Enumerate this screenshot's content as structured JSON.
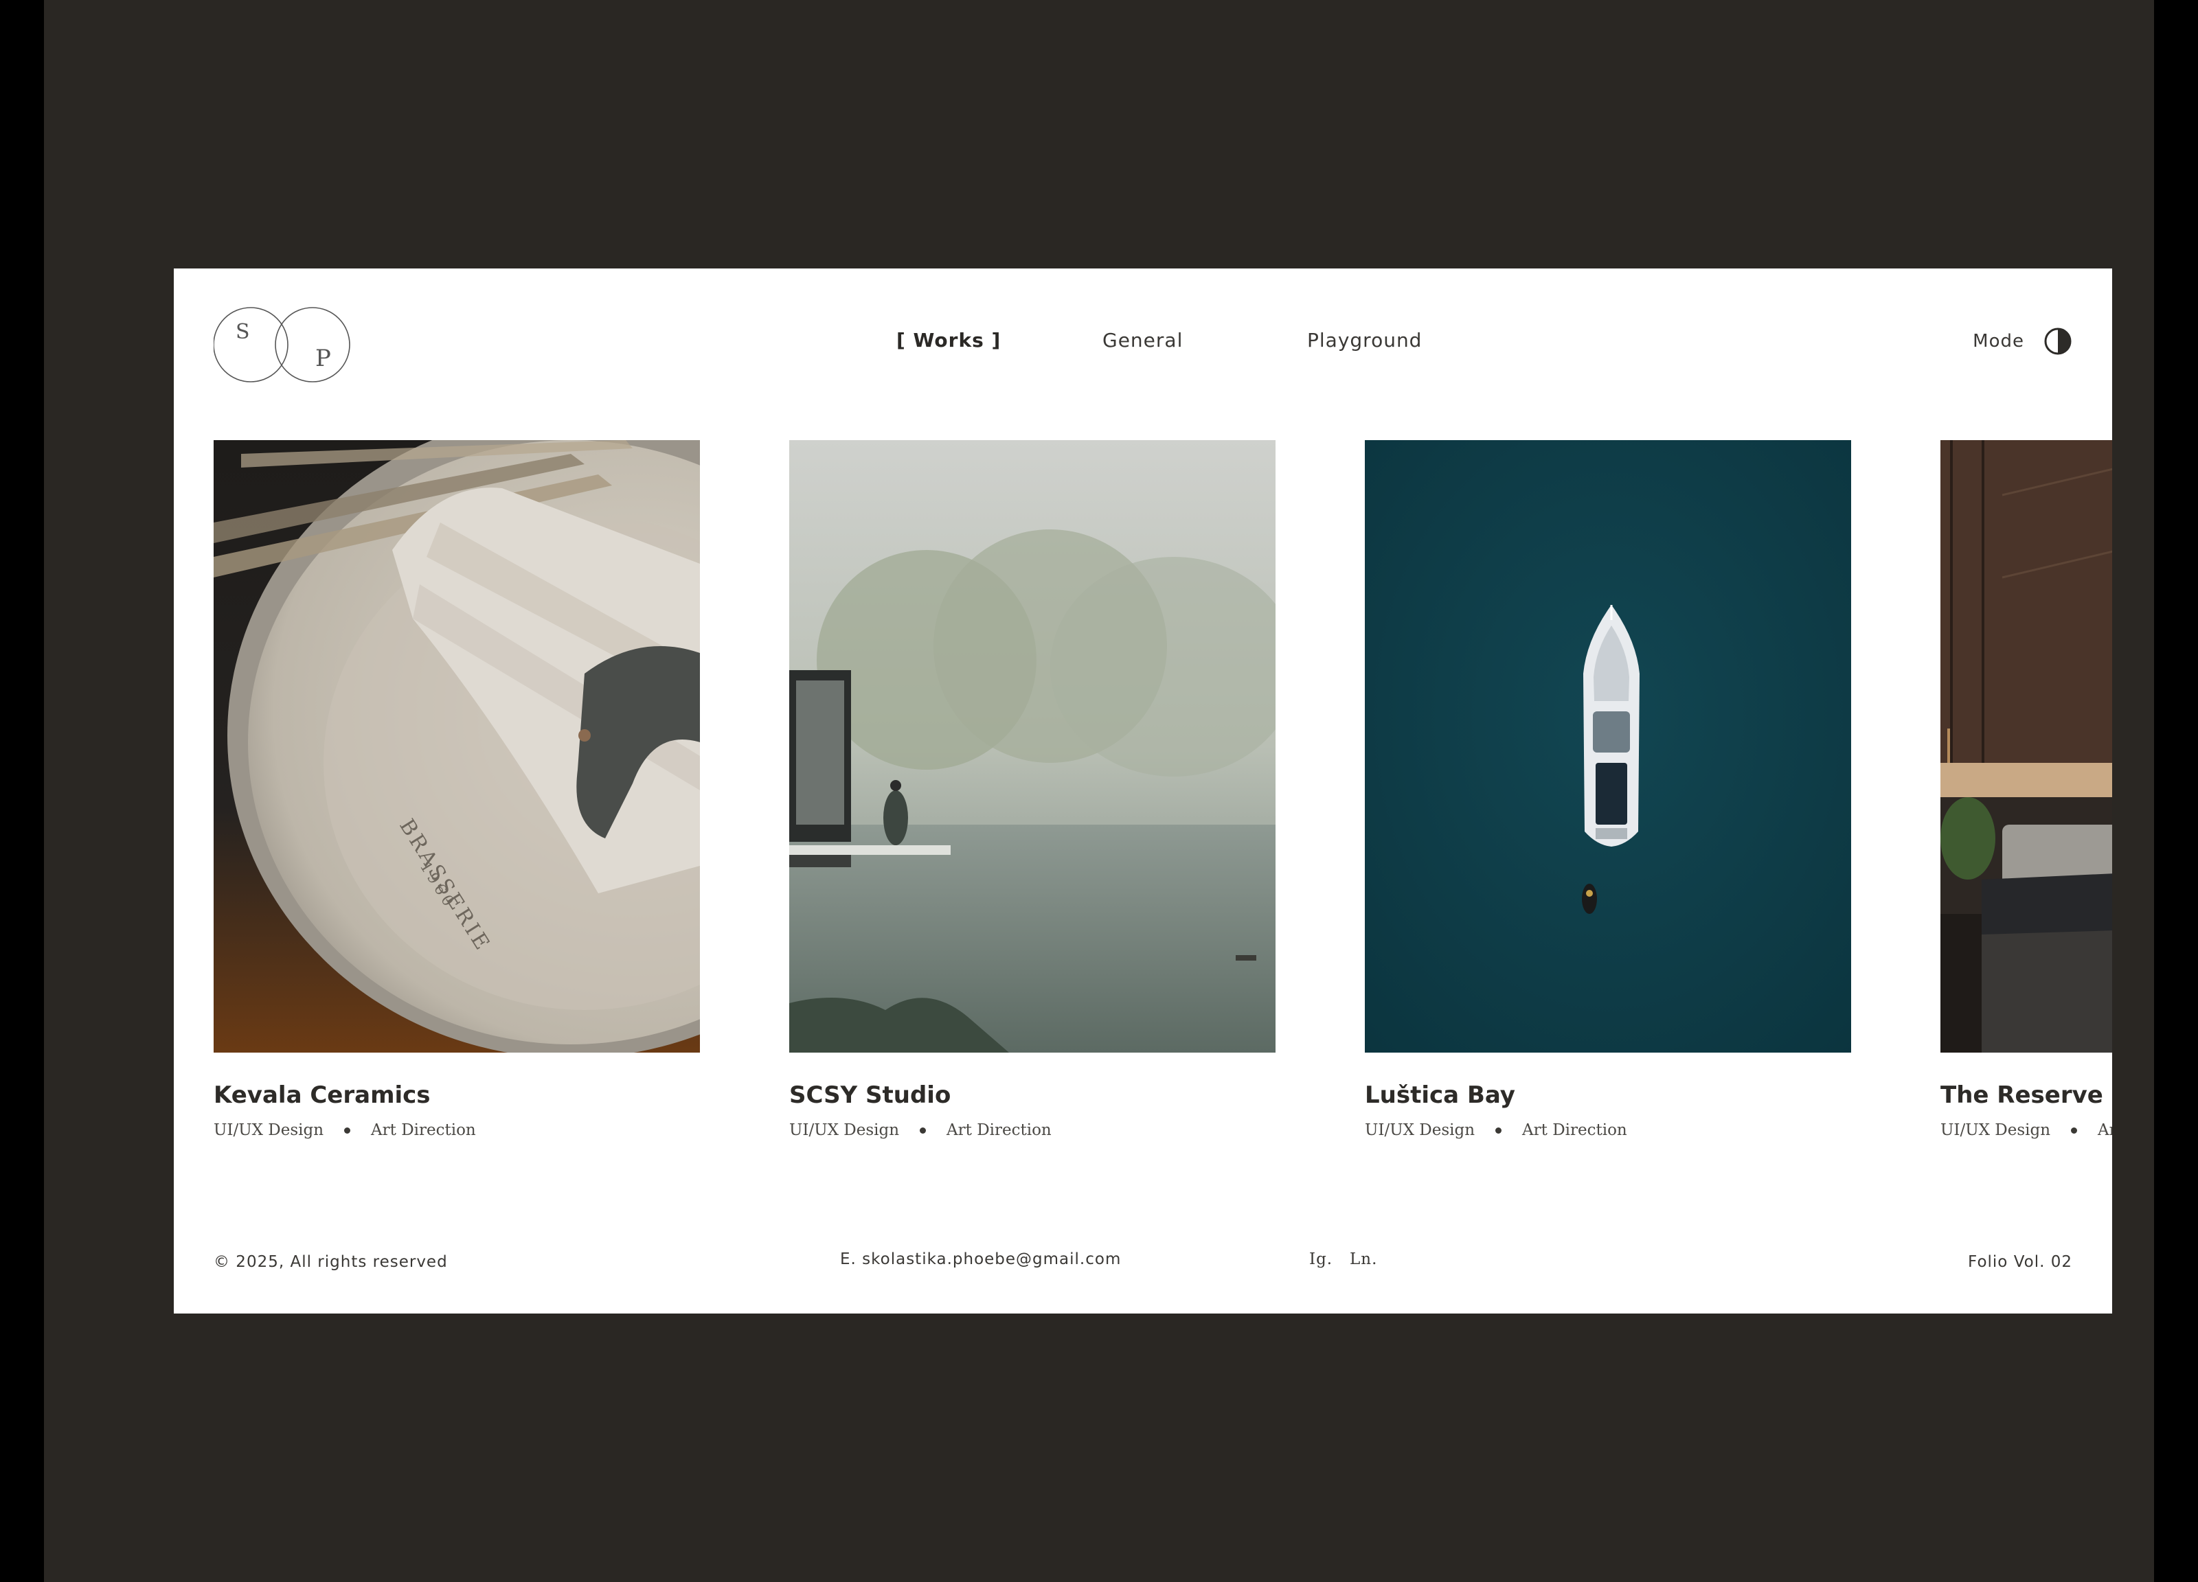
{
  "header": {
    "logo_letters": [
      "S",
      "P"
    ],
    "nav": [
      {
        "label": "[ Works ]",
        "active": true
      },
      {
        "label": "General",
        "active": false
      },
      {
        "label": "Playground",
        "active": false
      }
    ],
    "mode_label": "Mode"
  },
  "projects": [
    {
      "title": "Kevala Ceramics",
      "tags": [
        "UI/UX Design",
        "Art Direction"
      ],
      "image": "ceramic plate with napkin and forks"
    },
    {
      "title": "SCSY Studio",
      "tags": [
        "UI/UX Design",
        "Art Direction"
      ],
      "image": "misty lake with pavilion and figure"
    },
    {
      "title": "Luštica Bay",
      "tags": [
        "UI/UX Design",
        "Art Direction"
      ],
      "image": "aerial view of yacht on dark teal water"
    },
    {
      "title": "The Reserve Res",
      "tags": [
        "UI/UX Design",
        "Art D"
      ],
      "image": "dark hotel bedroom interior"
    }
  ],
  "footer": {
    "copyright": "© 2025, All rights reserved",
    "email": "E. skolastika.phoebe@gmail.com",
    "social": [
      "Ig.",
      "Ln."
    ],
    "edition": "Folio Vol. 02"
  },
  "colors": {
    "backdrop": "#2a2723",
    "page": "#ffffff",
    "text": "#2d2b28",
    "teal_water": "#0d3a44"
  }
}
